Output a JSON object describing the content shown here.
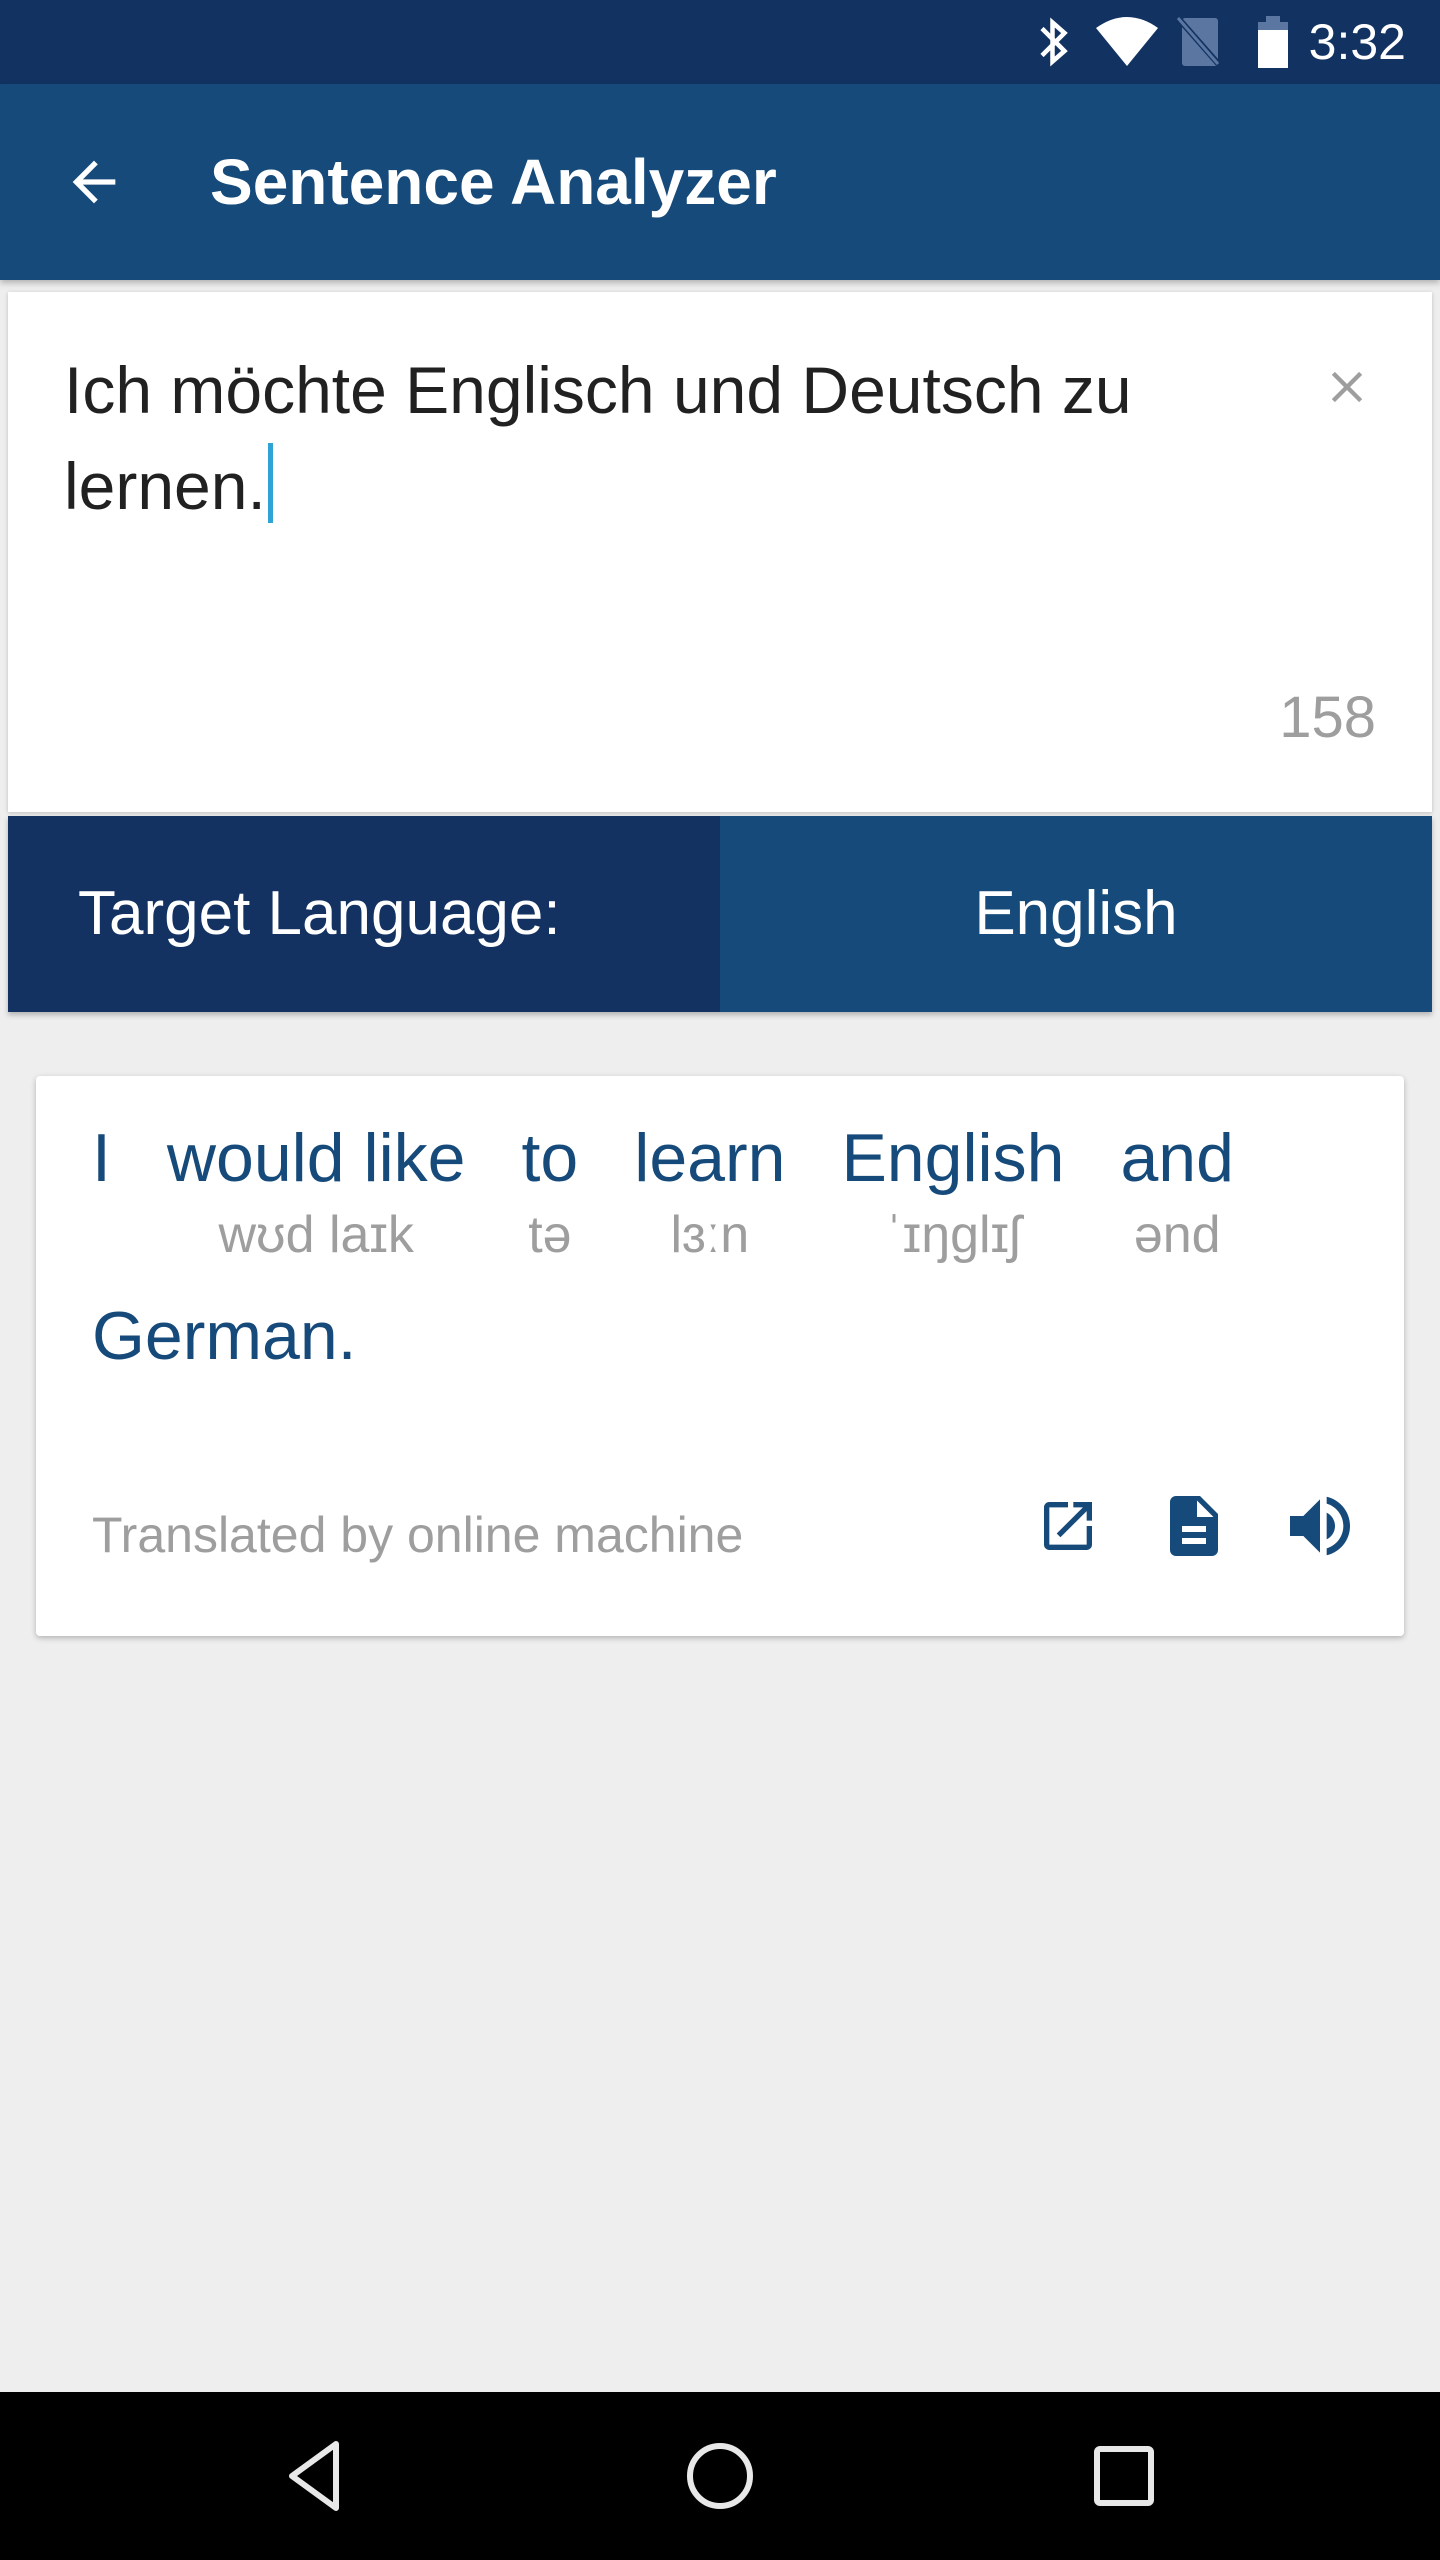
{
  "status_bar": {
    "time": "3:32",
    "icons": [
      "bluetooth-icon",
      "wifi-icon",
      "no-sim-icon",
      "battery-icon"
    ]
  },
  "app_bar": {
    "title": "Sentence Analyzer",
    "back_icon": "arrow-left-icon"
  },
  "input": {
    "text": "Ich möchte Englisch und Deutsch zu lernen.",
    "char_count": "158",
    "clear_icon": "close-icon"
  },
  "language": {
    "label": "Target Language:",
    "value": "English"
  },
  "result": {
    "words": [
      {
        "word": "I",
        "phonetic": ""
      },
      {
        "word": "would like",
        "phonetic": "wʊd laɪk"
      },
      {
        "word": "to",
        "phonetic": "tə"
      },
      {
        "word": "learn",
        "phonetic": "lɜːn"
      },
      {
        "word": "English",
        "phonetic": "ˈɪŋglɪʃ"
      },
      {
        "word": "and",
        "phonetic": "ənd"
      },
      {
        "word": "German.",
        "phonetic": ""
      }
    ],
    "source_note": "Translated by online machine",
    "actions": [
      "open-in-new-icon",
      "document-icon",
      "volume-icon"
    ]
  },
  "colors": {
    "status_bar": "#123262",
    "primary": "#154a7a",
    "primary_dark": "#133262",
    "caret": "#2fa3d6",
    "secondary_text": "#9e9e9e"
  },
  "nav_bar": {
    "buttons": [
      "back-triangle-icon",
      "home-circle-icon",
      "recents-square-icon"
    ]
  }
}
